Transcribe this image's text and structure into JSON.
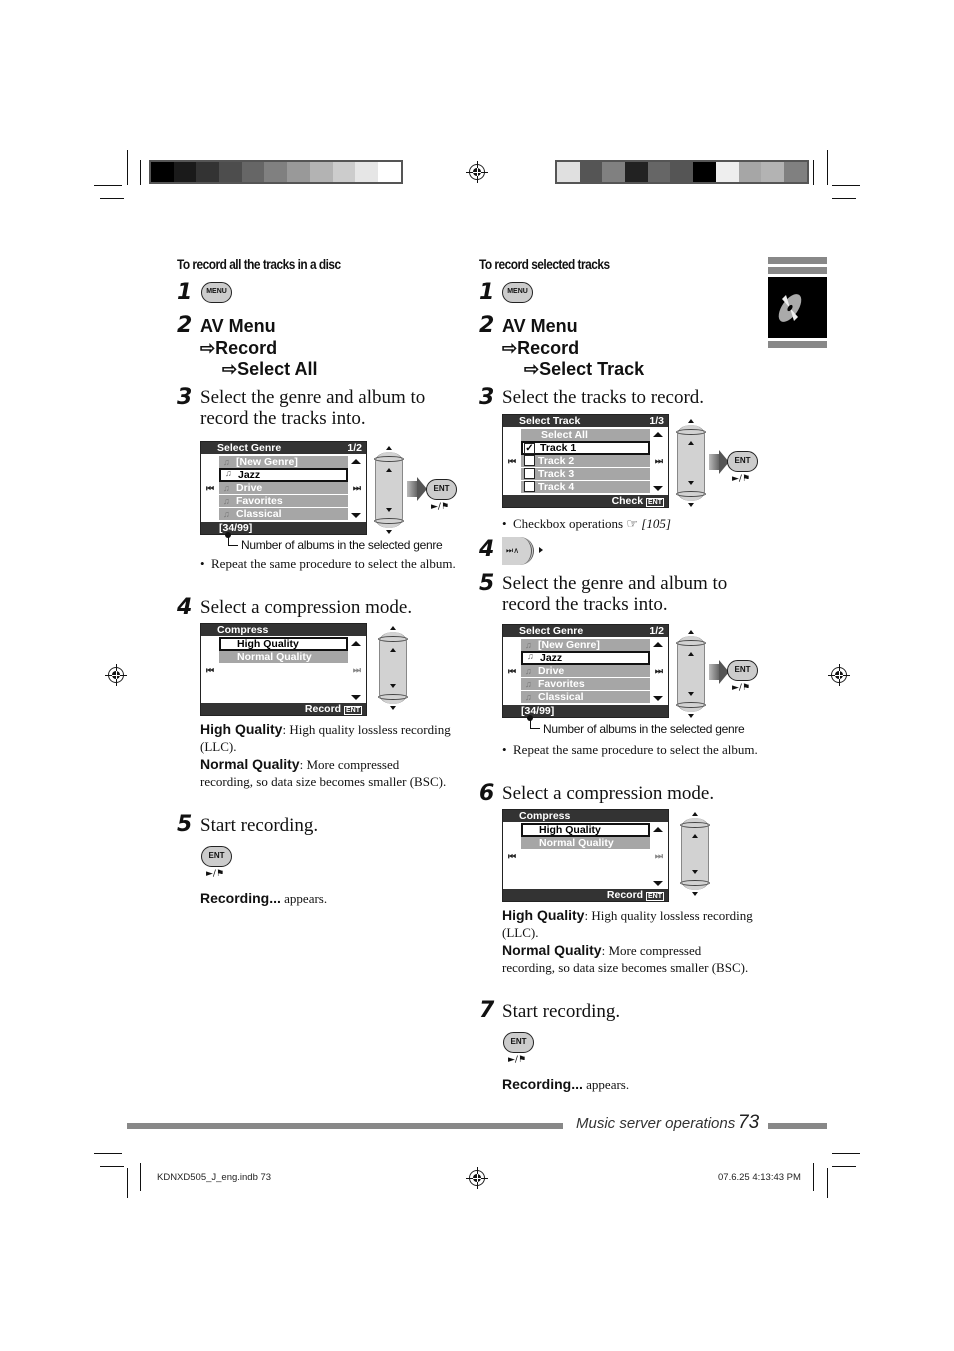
{
  "colorbar_left": [
    "#000000",
    "#1a1a1a",
    "#333333",
    "#4d4d4d",
    "#666666",
    "#808080",
    "#999999",
    "#b3b3b3",
    "#cccccc",
    "#e6e6e6",
    "#ffffff"
  ],
  "colorbar_right": [
    "#e0e0e0",
    "#555555",
    "#808080",
    "#222222",
    "#666666",
    "#555555",
    "#000000",
    "#eeeeee",
    "#a6a6a6",
    "#b3b3b3",
    "#808080"
  ],
  "left": {
    "heading": "To record all the tracks in a disc",
    "steps": [
      {
        "num": "1",
        "button": "MENU"
      },
      {
        "num": "2",
        "menu_path": [
          "AV Menu",
          "⇨Record",
          "⇨Select All"
        ]
      },
      {
        "num": "3",
        "text": "Select the genre and album to record the tracks into."
      },
      {
        "num": "4",
        "text": "Select a compression mode."
      },
      {
        "num": "5",
        "text": "Start recording."
      }
    ],
    "genre_screen": {
      "title": "Select Genre",
      "page": "1/2",
      "rows": [
        "[New Genre]",
        "Jazz",
        "Drive",
        "Favorites",
        "Classical"
      ],
      "selected": "Jazz",
      "footer": "[34/99]",
      "callout": "Number of albums in the selected genre"
    },
    "ent_button": "ENT",
    "play_pause": "►/⚑",
    "bullet_repeat": "Repeat the same procedure to select the album.",
    "compress_screen": {
      "title": "Compress",
      "rows": [
        "High Quality",
        "Normal Quality"
      ],
      "selected": "High Quality",
      "footer": "Record",
      "footer_icon": "ENT"
    },
    "desc_high_term": "High Quality",
    "desc_high_text": ": High quality lossless recording (LLC).",
    "desc_normal_term": "Normal Quality",
    "desc_normal_text": ": More compressed recording, so data size becomes smaller (BSC).",
    "recording_term": "Recording...",
    "recording_text": " appears."
  },
  "right": {
    "heading": "To record selected tracks",
    "steps": [
      {
        "num": "1",
        "button": "MENU"
      },
      {
        "num": "2",
        "menu_path": [
          "AV Menu",
          "⇨Record",
          "⇨Select Track"
        ]
      },
      {
        "num": "3",
        "text": "Select the tracks to record."
      },
      {
        "num": "4",
        "button": "⏭∧"
      },
      {
        "num": "5",
        "text": "Select the genre and album to record the tracks into."
      },
      {
        "num": "6",
        "text": "Select a compression mode."
      },
      {
        "num": "7",
        "text": "Start recording."
      }
    ],
    "track_screen": {
      "title": "Select Track",
      "page": "1/3",
      "rows": [
        {
          "label": "Select All",
          "checked": null
        },
        {
          "label": "Track 1",
          "checked": true
        },
        {
          "label": "Track 2",
          "checked": false
        },
        {
          "label": "Track 3",
          "checked": false
        },
        {
          "label": "Track 4",
          "checked": false
        }
      ],
      "selected": "Track 1",
      "footer": "Check",
      "footer_icon": "ENT"
    },
    "bullet_checkbox": "Checkbox operations",
    "checkbox_ref": "[105]",
    "genre_screen": {
      "title": "Select Genre",
      "page": "1/2",
      "rows": [
        "[New Genre]",
        "Jazz",
        "Drive",
        "Favorites",
        "Classical"
      ],
      "selected": "Jazz",
      "footer": "[34/99]",
      "callout": "Number of albums in the selected genre"
    },
    "bullet_repeat": "Repeat the same procedure to select the album.",
    "compress_screen": {
      "title": "Compress",
      "rows": [
        "High Quality",
        "Normal Quality"
      ],
      "selected": "High Quality",
      "footer": "Record",
      "footer_icon": "ENT"
    },
    "desc_high_term": "High Quality",
    "desc_high_text": ": High quality lossless recording (LLC).",
    "desc_normal_term": "Normal Quality",
    "desc_normal_text": ": More compressed recording, so data size becomes smaller (BSC).",
    "recording_term": "Recording...",
    "recording_text": " appears."
  },
  "footer": {
    "section": "Music server operations",
    "page": "73",
    "slug_file": "KDNXD505_J_eng.indb   73",
    "slug_date": "07.6.25   4:13:43 PM"
  }
}
